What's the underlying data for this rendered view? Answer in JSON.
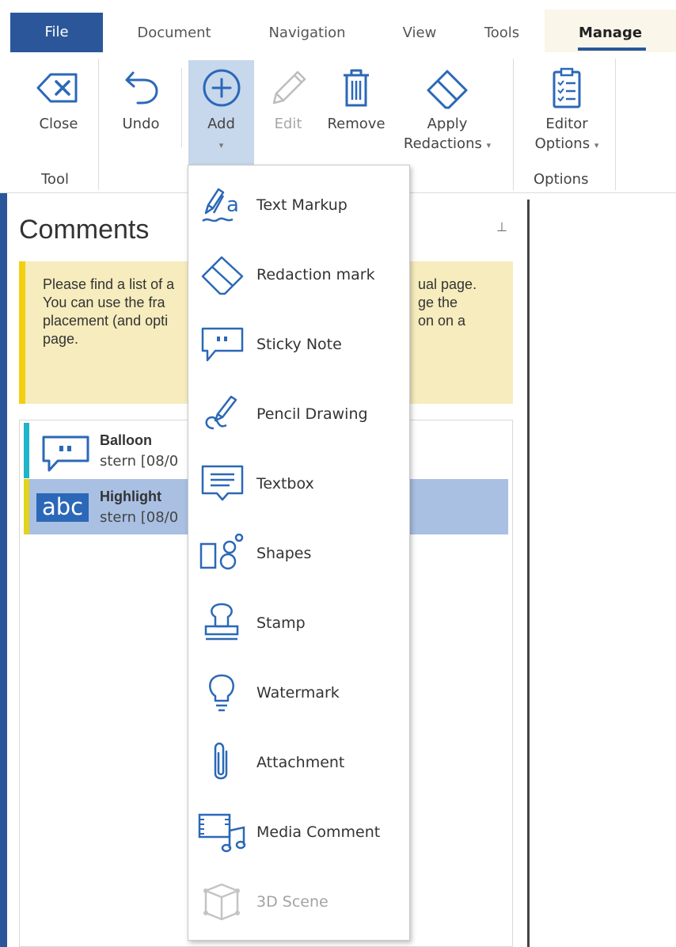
{
  "tabs": {
    "file": "File",
    "document": "Document",
    "navigation": "Navigation",
    "view": "View",
    "tools": "Tools",
    "manage": "Manage"
  },
  "ribbon": {
    "close": "Close",
    "undo": "Undo",
    "add": "Add",
    "edit": "Edit",
    "remove": "Remove",
    "apply_line1": "Apply",
    "apply_line2": "Redactions",
    "editor_line1": "Editor",
    "editor_line2": "Options",
    "group_tool": "Tool",
    "group_options": "Options"
  },
  "comments": {
    "title": "Comments",
    "pin_glyph": "⊥",
    "notice_lines": [
      "Please find a list of a",
      "You can use the fra",
      "placement (and opti",
      "page."
    ],
    "notice_tail_lines": [
      "ual page.",
      "ge the",
      "on on a"
    ],
    "items": [
      {
        "title": "Balloon",
        "meta": "stern [08/0",
        "bar_color": "#1fb4c9"
      },
      {
        "title": "Highlight",
        "meta": "stern [08/0",
        "bar_color": "#e2d41c",
        "icon_text": "abc"
      }
    ]
  },
  "menu": {
    "items": [
      {
        "label": "Text Markup",
        "icon": "text-markup-icon"
      },
      {
        "label": "Redaction mark",
        "icon": "eraser-icon"
      },
      {
        "label": "Sticky Note",
        "icon": "sticky-note-icon"
      },
      {
        "label": "Pencil Drawing",
        "icon": "pencil-drawing-icon"
      },
      {
        "label": "Textbox",
        "icon": "textbox-icon"
      },
      {
        "label": "Shapes",
        "icon": "shapes-icon"
      },
      {
        "label": "Stamp",
        "icon": "stamp-icon"
      },
      {
        "label": "Watermark",
        "icon": "lightbulb-icon"
      },
      {
        "label": "Attachment",
        "icon": "paperclip-icon"
      },
      {
        "label": "Media Comment",
        "icon": "media-icon"
      },
      {
        "label": "3D Scene",
        "icon": "cube-3d-icon",
        "disabled": true
      }
    ]
  },
  "colors": {
    "accent": "#2b579a",
    "icon_blue": "#2b68b7",
    "add_highlight": "#c7d7ec",
    "selected_row": "#a9c0e3",
    "notice_bg": "#f6ecbd",
    "notice_border": "#f2d00f"
  }
}
